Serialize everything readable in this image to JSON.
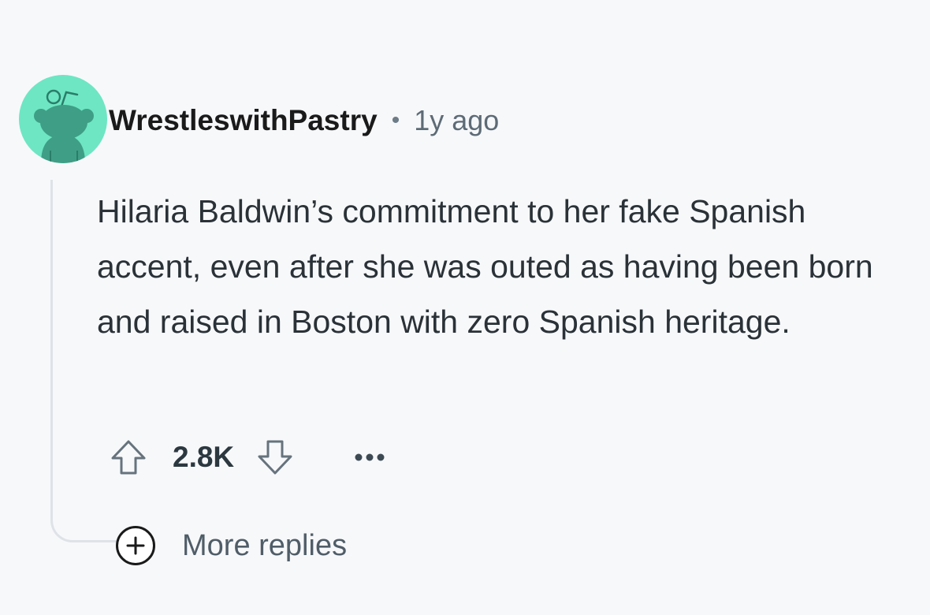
{
  "comment": {
    "author": "WrestleswithPastry",
    "separator": "•",
    "time_ago": "1y ago",
    "body": "Hilaria Baldwin’s commitment to her fake Spanish accent, even after she was outed as having been born and raised in Boston with zero Spanish heritage.",
    "score": "2.8K",
    "more_replies_label": "More replies",
    "avatar_bg_color": "#6ee6c3",
    "avatar_icon": "reddit-snoo-icon",
    "upvote_icon": "arrow-up-outline-icon",
    "downvote_icon": "arrow-down-outline-icon",
    "overflow_icon": "ellipsis-icon",
    "expand_icon": "plus-circle-icon"
  }
}
